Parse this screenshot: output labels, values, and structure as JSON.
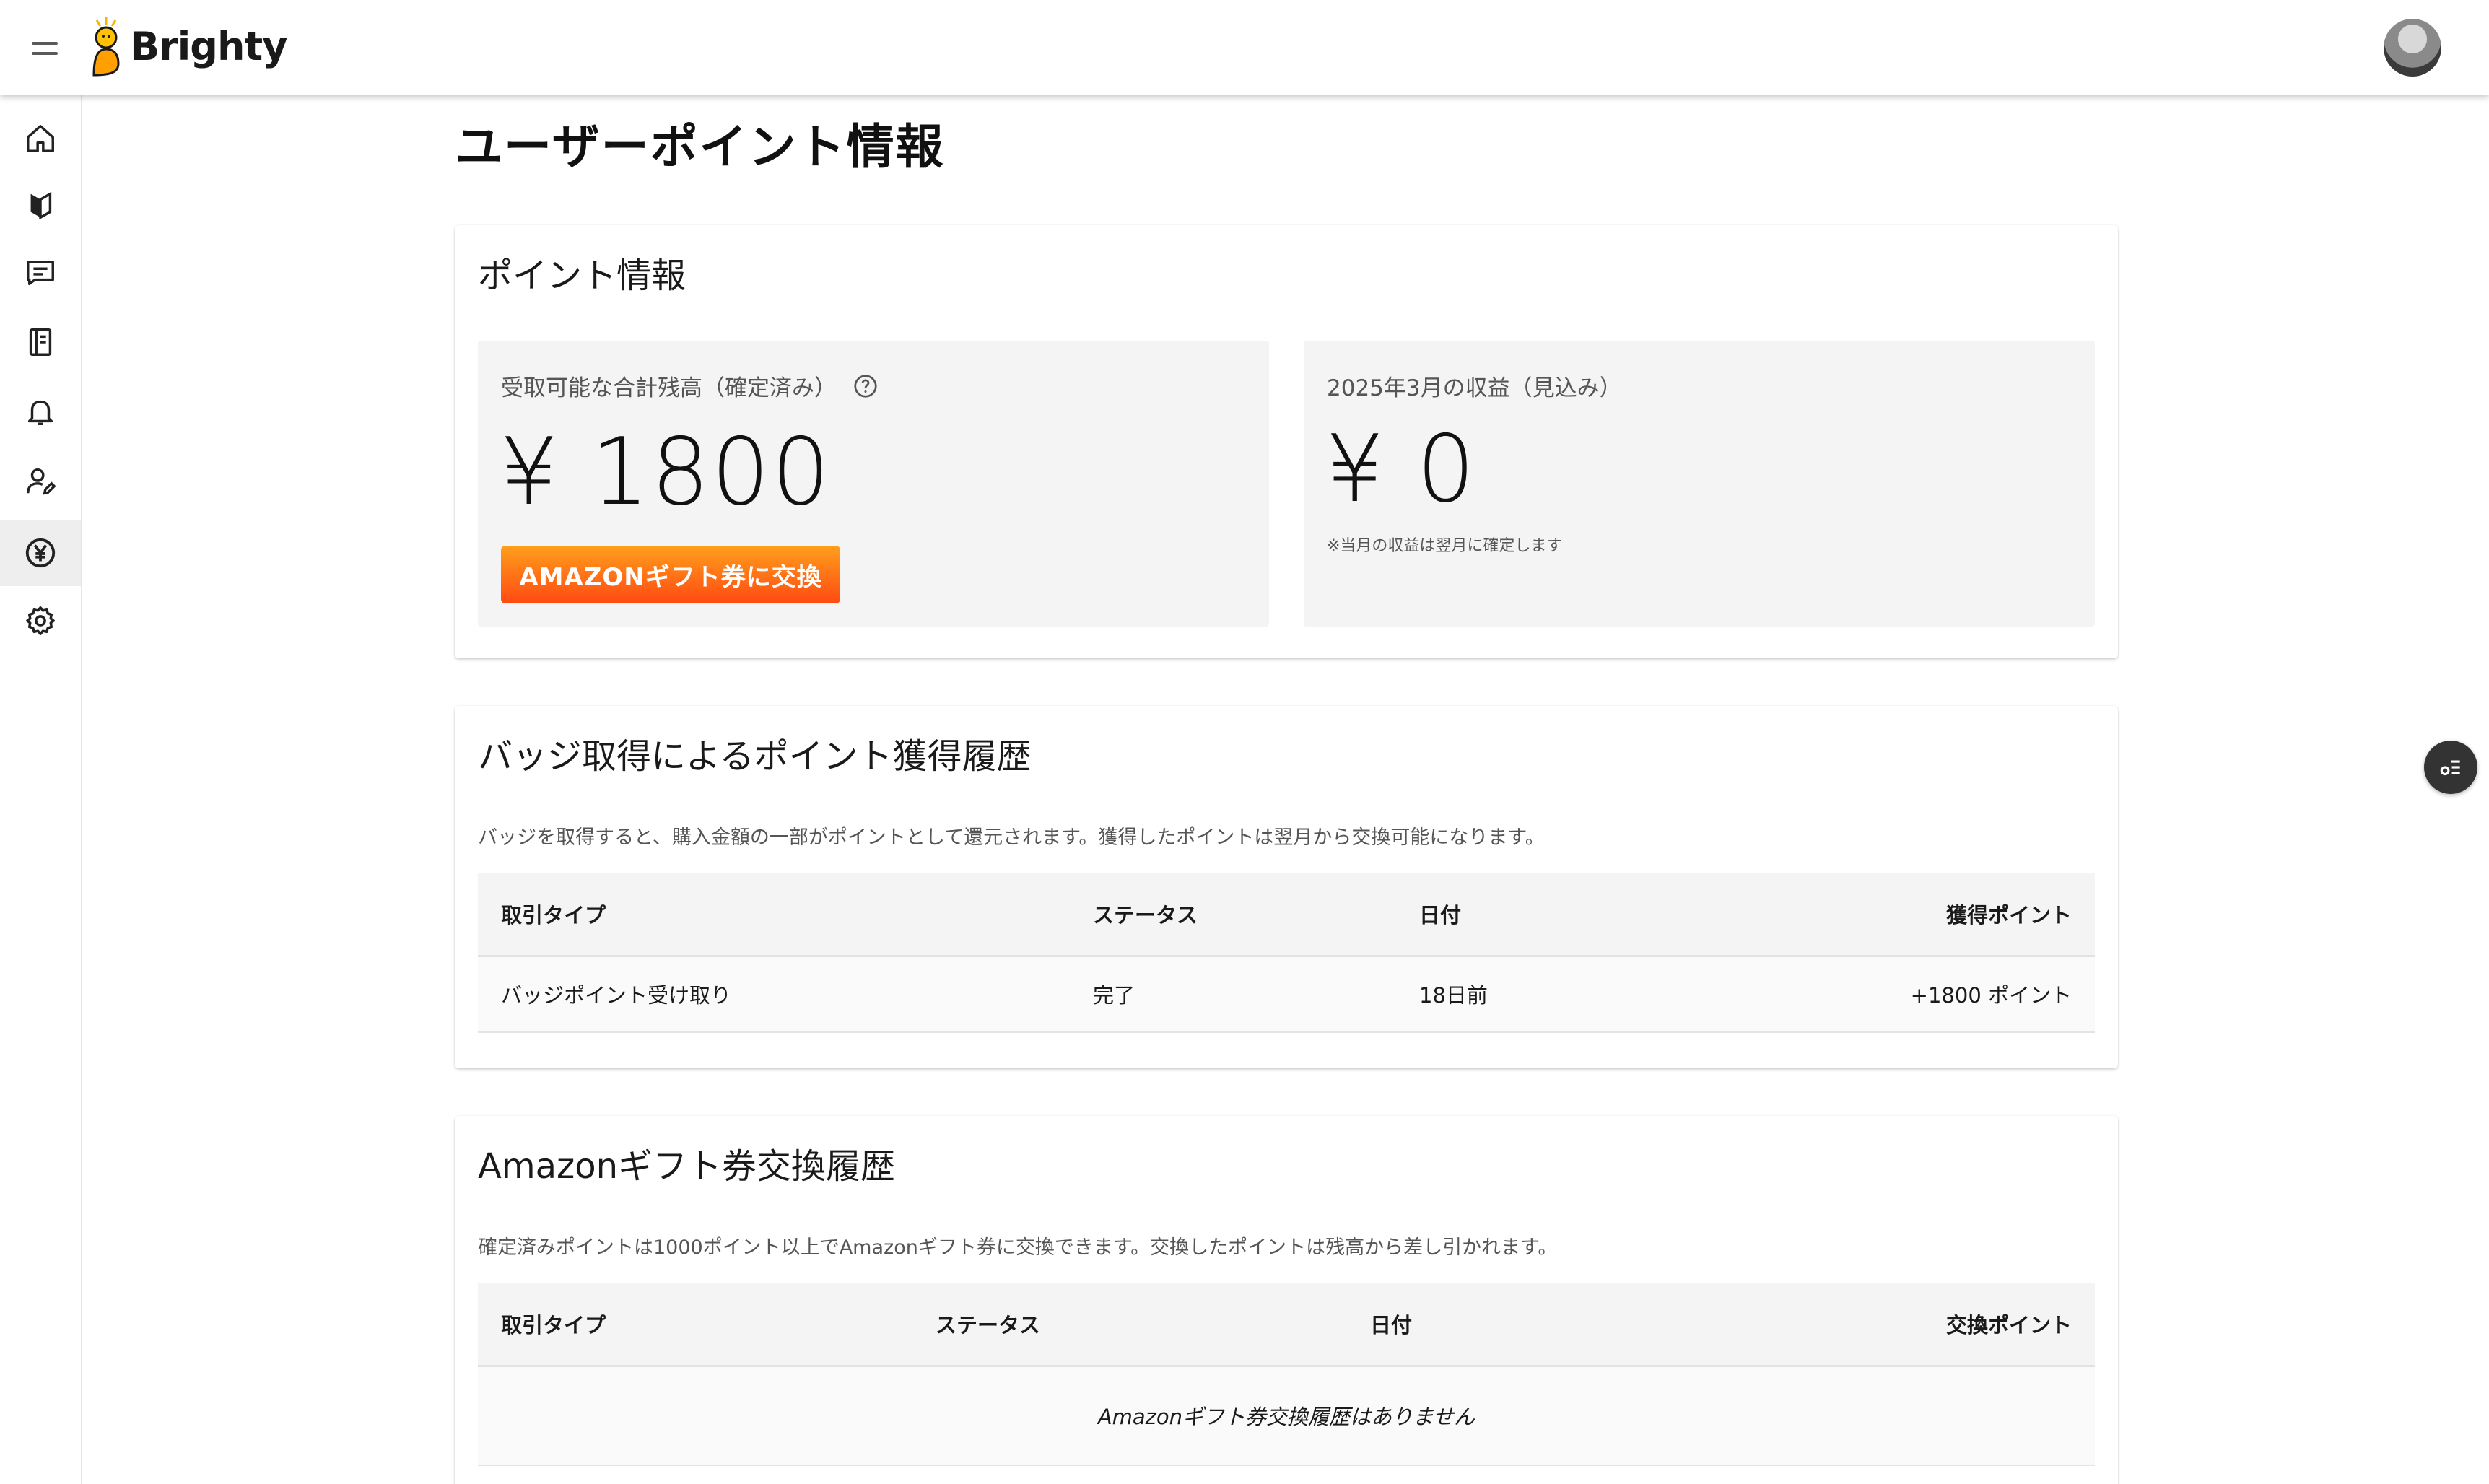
{
  "app": {
    "name": "Brighty"
  },
  "page": {
    "title": "ユーザーポイント情報"
  },
  "points": {
    "title": "ポイント情報",
    "balance": {
      "label": "受取可能な合計残高（確定済み）",
      "value": "¥ 1800",
      "button": "AMAZONギフト券に交換"
    },
    "monthly": {
      "label": "2025年3月の収益（見込み）",
      "value": "¥ 0",
      "note": "※当月の収益は翌月に確定します"
    }
  },
  "badge_history": {
    "title": "バッジ取得によるポイント獲得履歴",
    "description": "バッジを取得すると、購入金額の一部がポイントとして還元されます。獲得したポイントは翌月から交換可能になります。",
    "columns": [
      "取引タイプ",
      "ステータス",
      "日付",
      "獲得ポイント"
    ],
    "rows": [
      {
        "type": "バッジポイント受け取り",
        "status": "完了",
        "date": "18日前",
        "points": "+1800 ポイント"
      }
    ]
  },
  "amazon_history": {
    "title": "Amazonギフト券交換履歴",
    "description": "確定済みポイントは1000ポイント以上でAmazonギフト券に交換できます。交換したポイントは残高から差し引かれます。",
    "columns": [
      "取引タイプ",
      "ステータス",
      "日付",
      "交換ポイント"
    ],
    "empty": "Amazonギフト券交換履歴はありません"
  },
  "colors": {
    "accent_start": "#ff9f1c",
    "accent_end": "#ff4a12",
    "positive": "#2e7d32"
  },
  "sidebar_icons": [
    "home-icon",
    "beginner-icon",
    "chat-icon",
    "notebook-icon",
    "bell-icon",
    "user-edit-icon",
    "yen-icon",
    "gear-icon"
  ]
}
